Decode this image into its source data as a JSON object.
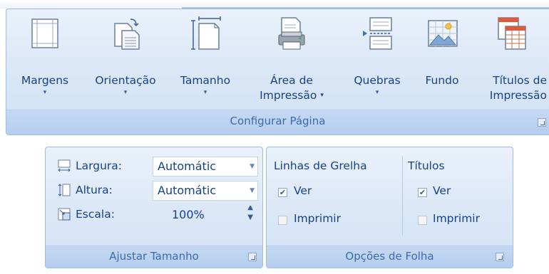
{
  "ribbon": {
    "group_caption": "Configurar Página",
    "buttons": [
      {
        "label_line1": "Margens",
        "label_line2": "",
        "icon": "margins-icon",
        "has_dropdown": true
      },
      {
        "label_line1": "Orientação",
        "label_line2": "",
        "icon": "orientation-icon",
        "has_dropdown": true
      },
      {
        "label_line1": "Tamanho",
        "label_line2": "",
        "icon": "page-size-icon",
        "has_dropdown": true
      },
      {
        "label_line1": "Área de",
        "label_line2": "Impressão",
        "icon": "print-area-icon",
        "has_dropdown": true
      },
      {
        "label_line1": "Quebras",
        "label_line2": "",
        "icon": "breaks-icon",
        "has_dropdown": true
      },
      {
        "label_line1": "Fundo",
        "label_line2": "",
        "icon": "background-icon",
        "has_dropdown": false
      },
      {
        "label_line1": "Títulos de",
        "label_line2": "Impressão",
        "icon": "print-titles-icon",
        "has_dropdown": false
      }
    ],
    "caret": "▾"
  },
  "scale_group": {
    "caption": "Ajustar Tamanho",
    "width_label": "Largura:",
    "width_value": "Automátic",
    "height_label": "Altura:",
    "height_value": "Automátic",
    "scale_label": "Escala:",
    "scale_value": "100%"
  },
  "sheet_options": {
    "caption": "Opções de Folha",
    "gridlines_header": "Linhas de Grelha",
    "headings_header": "Títulos",
    "view_label": "Ver",
    "print_label": "Imprimir",
    "gridlines_view_checked": true,
    "gridlines_print_checked": false,
    "headings_view_checked": true,
    "headings_print_checked": false
  },
  "colors": {
    "text": "#15428b",
    "caption_text": "#3e6aaa",
    "group_border": "#9ebbe0"
  }
}
